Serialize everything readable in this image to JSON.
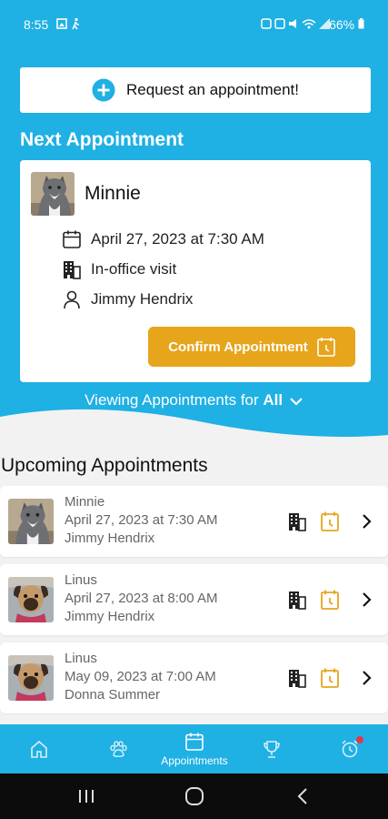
{
  "status_bar": {
    "time": "8:55",
    "battery": "66%"
  },
  "request_button": {
    "label": "Request an appointment!"
  },
  "next_appointment": {
    "title": "Next Appointment",
    "pet_name": "Minnie",
    "datetime": "April 27, 2023 at 7:30 AM",
    "visit_type": "In-office visit",
    "doctor": "Jimmy Hendrix",
    "confirm_label": "Confirm Appointment"
  },
  "viewing": {
    "prefix": "Viewing Appointments for ",
    "filter": "All"
  },
  "upcoming": {
    "title": "Upcoming Appointments",
    "items": [
      {
        "pet": "Minnie",
        "datetime": "April 27, 2023 at 7:30 AM",
        "doctor": "Jimmy Hendrix"
      },
      {
        "pet": "Linus",
        "datetime": "April 27, 2023 at 8:00 AM",
        "doctor": "Jimmy Hendrix"
      },
      {
        "pet": "Linus",
        "datetime": "May 09, 2023 at 7:00 AM",
        "doctor": "Donna Summer"
      }
    ]
  },
  "bottom_nav": {
    "items": [
      {
        "icon": "home-icon",
        "label": ""
      },
      {
        "icon": "paw-icon",
        "label": ""
      },
      {
        "icon": "calendar-icon",
        "label": "Appointments"
      },
      {
        "icon": "trophy-icon",
        "label": ""
      },
      {
        "icon": "alarm-icon",
        "label": ""
      }
    ]
  },
  "colors": {
    "brand_blue": "#1fb0e4",
    "accent_gold": "#e7a51c"
  }
}
